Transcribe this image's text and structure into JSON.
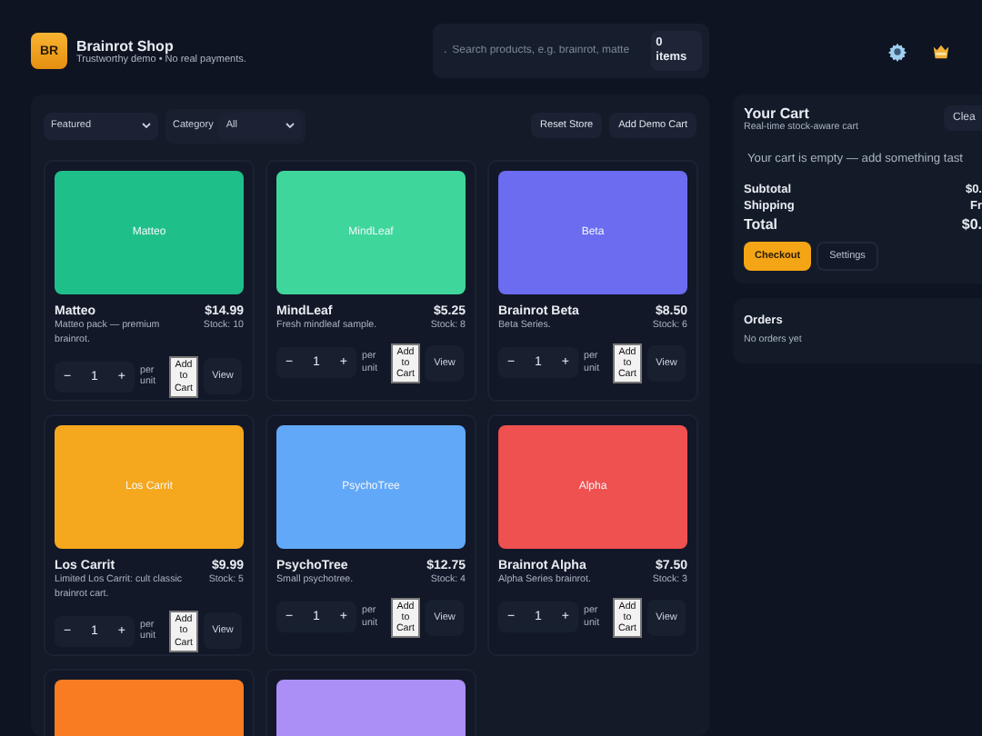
{
  "brand": {
    "logo": "BR",
    "title": "Brainrot Shop",
    "subtitle": "Trustworthy demo • No real payments."
  },
  "search": {
    "placeholder": "Search products, e.g. brainrot, matte",
    "marker": ".",
    "cart_count": "0 items"
  },
  "toolbar": {
    "sort": "Featured",
    "category_label": "Category",
    "category": "All",
    "buttons": [
      "Reset Store",
      "Add Demo Cart"
    ]
  },
  "products": [
    {
      "name": "Matteo",
      "image_label": "Matteo",
      "color": "#1fbf8a",
      "price": "$14.99",
      "description": "Matteo pack — premium brainrot.",
      "stock": "Stock: 10",
      "qty": "1",
      "minus": "−",
      "plus": "+",
      "unit": "per unit",
      "add": "Add to Cart",
      "view": "View"
    },
    {
      "name": "MindLeaf",
      "image_label": "MindLeaf",
      "color": "#3fd69c",
      "price": "$5.25",
      "description": "Fresh mindleaf sample.",
      "stock": "Stock: 8",
      "qty": "1",
      "minus": "−",
      "plus": "+",
      "unit": "per unit",
      "add": "Add to Cart",
      "view": "View"
    },
    {
      "name": "Brainrot Beta",
      "image_label": "Beta",
      "color": "#6b6cf0",
      "price": "$8.50",
      "description": "Beta Series.",
      "stock": "Stock: 6",
      "qty": "1",
      "minus": "−",
      "plus": "+",
      "unit": "per unit",
      "add": "Add to Cart",
      "view": "View"
    },
    {
      "name": "Los Carrit",
      "image_label": "Los Carrit",
      "color": "#f5a81d",
      "price": "$9.99",
      "description": "Limited Los Carrit: cult classic brainrot cart.",
      "stock": "Stock: 5",
      "qty": "1",
      "minus": "−",
      "plus": "+",
      "unit": "per unit",
      "add": "Add to Cart",
      "view": "View"
    },
    {
      "name": "PsychoTree",
      "image_label": "PsychoTree",
      "color": "#62a8f8",
      "price": "$12.75",
      "description": "Small psychotree.",
      "stock": "Stock: 4",
      "qty": "1",
      "minus": "−",
      "plus": "+",
      "unit": "per unit",
      "add": "Add to Cart",
      "view": "View"
    },
    {
      "name": "Brainrot Alpha",
      "image_label": "Alpha",
      "color": "#ef5050",
      "price": "$7.50",
      "description": "Alpha Series brainrot.",
      "stock": "Stock: 3",
      "qty": "1",
      "minus": "−",
      "plus": "+",
      "unit": "per unit",
      "add": "Add to Cart",
      "view": "View"
    },
    {
      "color": "#f97c22"
    },
    {
      "color": "#ab8ef6"
    }
  ],
  "cart": {
    "title": "Your Cart",
    "subtitle": "Real-time stock-aware cart",
    "clear": "Clea",
    "empty": "Your cart is empty — add something tast",
    "totals": [
      {
        "label": "Subtotal",
        "value": "$0.",
        "kind": "normal"
      },
      {
        "label": "Shipping",
        "value": "Fr",
        "kind": "normal"
      },
      {
        "label": "Total",
        "value": "$0.",
        "kind": "grand"
      }
    ],
    "checkout": "Checkout",
    "settings": "Settings"
  },
  "orders": {
    "title": "Orders",
    "empty": "No orders yet"
  }
}
